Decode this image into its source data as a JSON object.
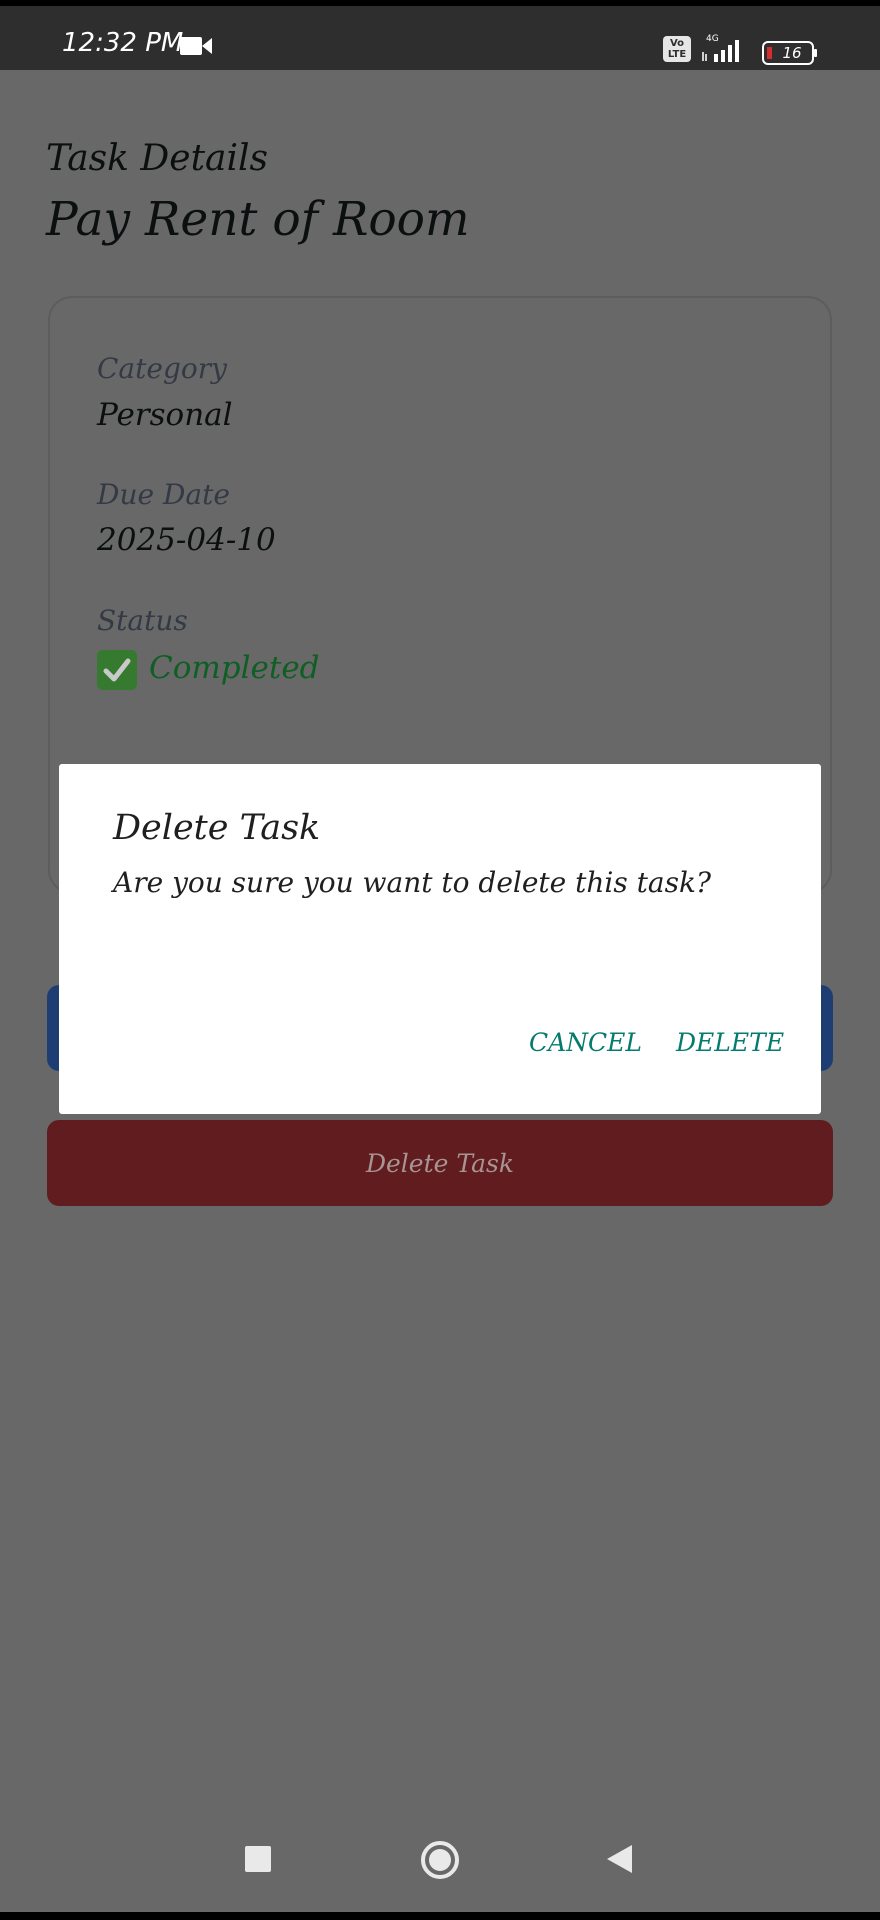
{
  "status_bar": {
    "time": "12:32 PM",
    "volte": "Vo LTE",
    "network": "4G",
    "battery_level": "16"
  },
  "page": {
    "header_label": "Task Details",
    "task_title": "Pay Rent of Room"
  },
  "details": {
    "category_label": "Category",
    "category_value": "Personal",
    "due_date_label": "Due Date",
    "due_date_value": "2025-04-10",
    "status_label": "Status",
    "status_value": "Completed"
  },
  "actions": {
    "delete_task_label": "Delete Task"
  },
  "dialog": {
    "title": "Delete Task",
    "message": "Are you sure you want to delete this task?",
    "cancel_label": "CANCEL",
    "delete_label": "DELETE"
  },
  "colors": {
    "accent_teal": "#047b6e",
    "status_green": "#0f5e24",
    "edit_button_blue": "#1e3d73",
    "delete_button_red": "#611c1f",
    "scrim": "#686868"
  },
  "icons": {
    "status": "check-mark-icon",
    "nav_recents": "square-icon",
    "nav_home": "circle-icon",
    "nav_back": "triangle-back-icon"
  }
}
